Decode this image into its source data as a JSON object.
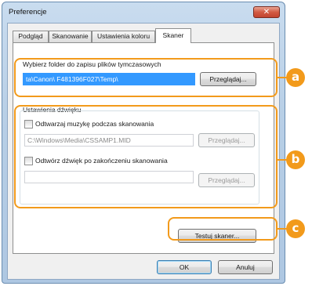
{
  "window": {
    "title": "Preferencje",
    "close_label": "✕"
  },
  "tabs": [
    "Podgląd",
    "Skanowanie",
    "Ustawienia koloru",
    "Skaner"
  ],
  "folder": {
    "label": "Wybierz folder do zapisu plików tymczasowych",
    "path": "ta\\Canon\\          F481396F027\\Temp\\",
    "browse": "Przeglądaj..."
  },
  "sound": {
    "label": "Ustawienia dźwięku",
    "play_music": "Odtwarzaj muzykę podczas skanowania",
    "music_path": "C:\\Windows\\Media\\CSSAMP1.MID",
    "browse1": "Przeglądaj...",
    "play_end": "Odtwórz dźwięk po zakończeniu skanowania",
    "end_path": "",
    "browse2": "Przeglądaj..."
  },
  "test_button": "Testuj skaner...",
  "footer": {
    "ok": "OK",
    "cancel": "Anuluj"
  },
  "markers": {
    "a": "a",
    "b": "b",
    "c": "c"
  },
  "colors": {
    "accent": "#f29a1b",
    "selection": "#3399ff"
  }
}
